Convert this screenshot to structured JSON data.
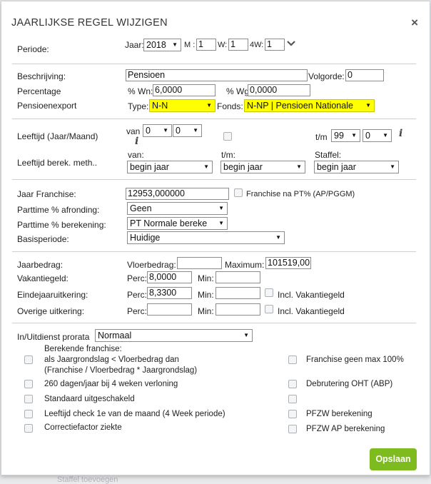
{
  "title": "JAARLIJKSE REGEL WIJZIGEN",
  "close": "×",
  "periode": {
    "label": "Periode:",
    "jaar_label": "Jaar:",
    "jaar": "2018",
    "m_label": "M :",
    "m": "1",
    "w_label": "W:",
    "w": "1",
    "w4_label": "4W:",
    "w4": "1"
  },
  "beschrijving": {
    "label": "Beschrijving:",
    "value": "Pensioen",
    "volgorde_label": "Volgorde:",
    "volgorde": "0"
  },
  "percentage": {
    "label": "Percentage",
    "wn_label": "% Wn:",
    "wn": "6,0000",
    "wg_label": "% Wg:",
    "wg": "0,0000"
  },
  "pensioenexport": {
    "label": "Pensioenexport",
    "type_label": "Type:",
    "type": "N-N",
    "fonds_label": "Fonds:",
    "fonds": "N-NP | Pensioen Nationale"
  },
  "leeftijd": {
    "label": "Leeftijd (Jaar/Maand)",
    "van_label": "van",
    "van_jaar": "0",
    "van_maand": "0",
    "tm_label": "t/m",
    "tm_jaar": "99",
    "tm_maand": "0",
    "info": "i"
  },
  "berek": {
    "label": "Leeftijd berek. meth..",
    "van_label": "van:",
    "van": "begin jaar",
    "tm_label": "t/m:",
    "tm": "begin jaar",
    "staffel_label": "Staffel:",
    "staffel": "begin jaar"
  },
  "franchise": {
    "label": "Jaar Franchise:",
    "value": "12953,000000",
    "na_label": "Franchise na PT% (AP/PGGM)"
  },
  "parttime_afronding": {
    "label": "Parttime % afronding:",
    "value": "Geen"
  },
  "parttime_berekening": {
    "label": "Parttime % berekening:",
    "value": "PT Normale bereke"
  },
  "basisperiode": {
    "label": "Basisperiode:",
    "value": "Huidige"
  },
  "jaarbedrag": {
    "label": "Jaarbedrag:",
    "vloer_label": "Vloerbedrag:",
    "vloer": "",
    "max_label": "Maximum:",
    "max": "101519,00"
  },
  "vakantiegeld": {
    "label": "Vakantiegeld:",
    "perc_label": "Perc:",
    "perc": "8,0000",
    "min_label": "Min:",
    "min": ""
  },
  "eindejaar": {
    "label": "Eindejaaruitkering:",
    "perc_label": "Perc:",
    "perc": "8,3300",
    "min_label": "Min:",
    "min": "",
    "incl_label": "Incl. Vakantiegeld"
  },
  "overige": {
    "label": "Overige uitkering:",
    "perc_label": "Perc:",
    "perc": "",
    "min_label": "Min:",
    "min": "",
    "incl_label": "Incl. Vakantiegeld"
  },
  "prorata": {
    "label": "In/Uitdienst prorata",
    "value": "Normaal"
  },
  "options_left": {
    "berekende_l1": "Berekende franchise:",
    "berekende_l2": "als Jaargrondslag < Vloerbedrag dan",
    "berekende_l3": "(Franchise / Vloerbedrag * Jaargrondslag)",
    "dagen260": "260 dagen/jaar bij 4 weken verloning",
    "standaard": "Standaard uitgeschakeld",
    "leeftijd_check": "Leeftijd check 1e van de maand (4 Week periode)",
    "correctie": "Correctiefactor ziekte"
  },
  "options_right": {
    "franchise_geen_max": "Franchise geen max 100%",
    "debrutering": "Debrutering OHT (ABP)",
    "pfzw": "PFZW berekening",
    "pfzw_ap": "PFZW AP berekening"
  },
  "save_label": "Opslaan",
  "background_hint": "Staffel toevoegen"
}
